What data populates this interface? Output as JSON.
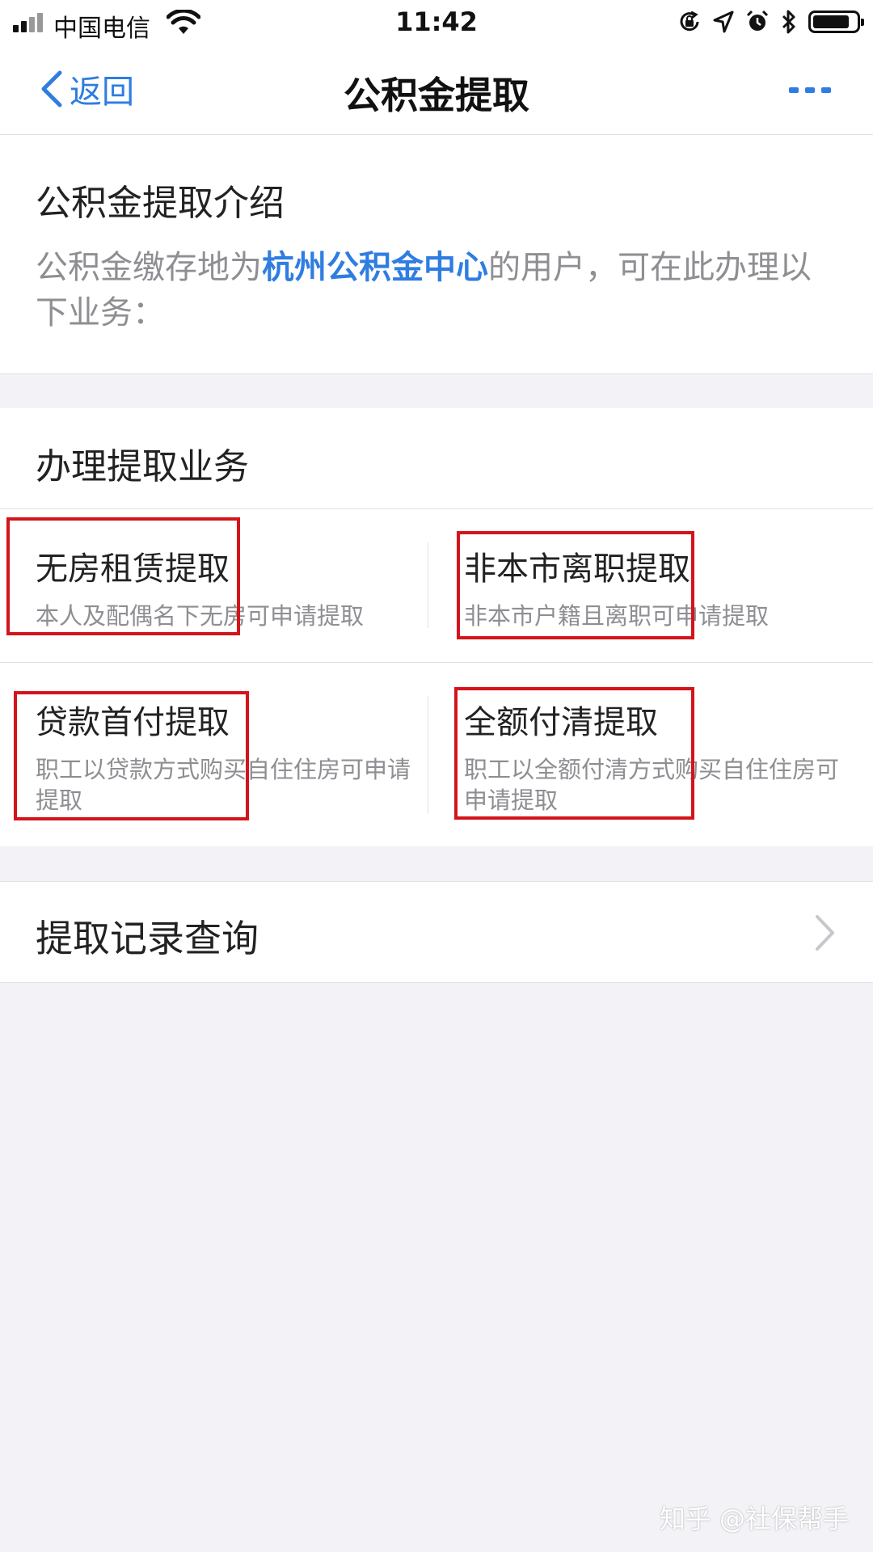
{
  "status_bar": {
    "carrier": "中国电信",
    "time": "11:42"
  },
  "nav": {
    "back_label": "返回",
    "title": "公积金提取"
  },
  "intro": {
    "title": "公积金提取介绍",
    "desc_prefix": "公积金缴存地为",
    "desc_highlight": "杭州公积金中心",
    "desc_suffix": "的用户，可在此办理以下业务："
  },
  "services": {
    "title": "办理提取业务",
    "items": [
      {
        "name": "无房租赁提取",
        "desc": "本人及配偶名下无房可申请提取"
      },
      {
        "name": "非本市离职提取",
        "desc": "非本市户籍且离职可申请提取"
      },
      {
        "name": "贷款首付提取",
        "desc": "职工以贷款方式购买自住住房可申请提取"
      },
      {
        "name": "全额付清提取",
        "desc": "职工以全额付清方式购买自住住房可申请提取"
      }
    ]
  },
  "records": {
    "label": "提取记录查询"
  },
  "watermark": "知乎 @社保帮手",
  "colors": {
    "accent": "#2f7de1",
    "highlight_box": "#d3141c",
    "background": "#f3f3f7"
  },
  "icons": [
    "signal-icon",
    "wifi-icon",
    "rotation-lock-icon",
    "location-icon",
    "alarm-icon",
    "bluetooth-icon",
    "battery-icon",
    "back-chevron-icon",
    "more-icon",
    "chevron-right-icon"
  ]
}
